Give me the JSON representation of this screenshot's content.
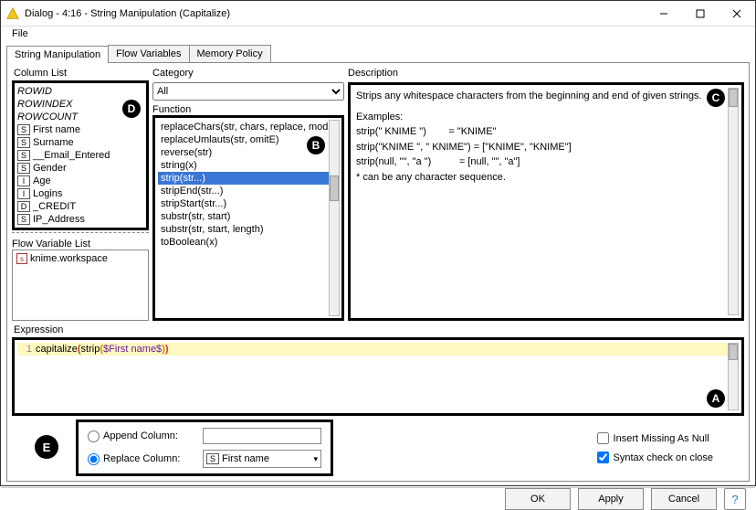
{
  "window": {
    "title": "Dialog - 4:16 - String Manipulation (Capitalize)",
    "menu": {
      "file": "File"
    }
  },
  "tabs": {
    "t0": "String Manipulation",
    "t1": "Flow Variables",
    "t2": "Memory Policy"
  },
  "labels": {
    "column_list": "Column List",
    "flow_variable_list": "Flow Variable List",
    "category": "Category",
    "function": "Function",
    "description": "Description",
    "expression": "Expression"
  },
  "columns": {
    "meta": {
      "rowid": "ROWID",
      "rowindex": "ROWINDEX",
      "rowcount": "ROWCOUNT"
    },
    "items": [
      {
        "type": "S",
        "name": "First name"
      },
      {
        "type": "S",
        "name": "Surname"
      },
      {
        "type": "S",
        "name": "__Email_Entered"
      },
      {
        "type": "S",
        "name": "Gender"
      },
      {
        "type": "I",
        "name": "Age"
      },
      {
        "type": "I",
        "name": "Logins"
      },
      {
        "type": "D",
        "name": "_CREDIT"
      },
      {
        "type": "S",
        "name": "IP_Address"
      }
    ]
  },
  "flow_vars": {
    "items": [
      {
        "name": "knime.workspace"
      }
    ]
  },
  "category": {
    "selected": "All"
  },
  "functions": {
    "items": [
      {
        "label": "replaceChars(str, chars, replace, modifiers)"
      },
      {
        "label": "replaceUmlauts(str, omitE)"
      },
      {
        "label": "reverse(str)"
      },
      {
        "label": "string(x)"
      },
      {
        "label": "strip(str...)",
        "selected": true
      },
      {
        "label": "stripEnd(str...)"
      },
      {
        "label": "stripStart(str...)"
      },
      {
        "label": "substr(str, start)"
      },
      {
        "label": "substr(str, start, length)"
      },
      {
        "label": "toBoolean(x)"
      }
    ]
  },
  "description": {
    "line1": "Strips any whitespace characters from the beginning and end of given strings.",
    "examples_h": "Examples:",
    "ex1_l": "strip(\" KNIME \")",
    "ex1_r": "= \"KNIME\"",
    "ex2_l": "strip(\"KNIME \", \" KNIME\")",
    "ex2_r": "= [\"KNIME\", \"KNIME\"]",
    "ex3_l": "strip(null, \"\", \"a \")",
    "ex3_r": "= [null, \"\", \"a\"]",
    "note": "* can be any character sequence."
  },
  "expression": {
    "line_no": "1",
    "tokens": {
      "fn1": "capitalize",
      "op1": "(",
      "fn2": "strip",
      "op2": "(",
      "var": "$First name$",
      "cp2": ")",
      "cp1": ")"
    }
  },
  "output": {
    "append_label": "Append Column:",
    "append_value": "",
    "replace_label": "Replace Column:",
    "replace_value": "First name",
    "replace_type": "S"
  },
  "options": {
    "insert_missing": "Insert Missing As Null",
    "syntax_check": "Syntax check on close"
  },
  "buttons": {
    "ok": "OK",
    "apply": "Apply",
    "cancel": "Cancel",
    "help": "?"
  },
  "badge": {
    "A": "A",
    "B": "B",
    "C": "C",
    "D": "D",
    "E": "E"
  }
}
